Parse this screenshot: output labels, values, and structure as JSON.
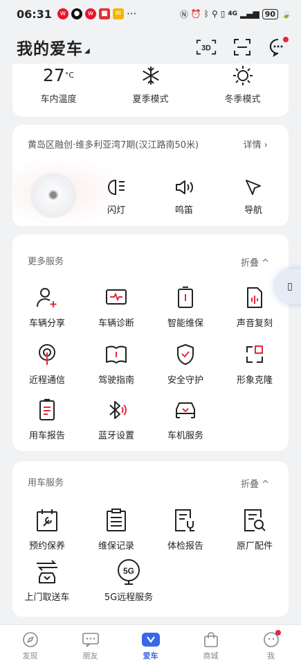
{
  "status": {
    "time": "06:31",
    "right_text": "4G",
    "battery": "90"
  },
  "header": {
    "title": "我的爱车",
    "btn_3d": "3D"
  },
  "climate": [
    {
      "value": "27",
      "unit": "°C",
      "label": "车内温度"
    },
    {
      "label": "夏季模式",
      "icon": "snowflake-icon"
    },
    {
      "label": "冬季模式",
      "icon": "sun-icon"
    }
  ],
  "location": {
    "address": "黄岛区融创·维多利亚湾7期(汉江路南50米)",
    "detail": "详情"
  },
  "quick_actions": [
    {
      "label": "闪灯",
      "icon": "headlight-icon"
    },
    {
      "label": "鸣笛",
      "icon": "horn-icon"
    },
    {
      "label": "导航",
      "icon": "navigation-icon"
    }
  ],
  "more_services": {
    "title": "更多服务",
    "fold": "折叠",
    "items": [
      {
        "label": "车辆分享",
        "icon": "user-add-icon"
      },
      {
        "label": "车辆诊断",
        "icon": "diagnosis-icon"
      },
      {
        "label": "智能维保",
        "icon": "battery-icon"
      },
      {
        "label": "声音复刻",
        "icon": "sound-clone-icon"
      },
      {
        "label": "近程通信",
        "icon": "signal-icon"
      },
      {
        "label": "驾驶指南",
        "icon": "book-icon"
      },
      {
        "label": "安全守护",
        "icon": "shield-icon"
      },
      {
        "label": "形象克隆",
        "icon": "clone-icon"
      },
      {
        "label": "用车报告",
        "icon": "report-icon"
      },
      {
        "label": "蓝牙设置",
        "icon": "bluetooth-icon"
      },
      {
        "label": "车机服务",
        "icon": "car-service-icon"
      }
    ]
  },
  "car_services": {
    "title": "用车服务",
    "fold": "折叠",
    "items": [
      {
        "label": "预约保养",
        "icon": "calendar-wrench-icon"
      },
      {
        "label": "维保记录",
        "icon": "clipboard-icon"
      },
      {
        "label": "体检报告",
        "icon": "checkup-icon"
      },
      {
        "label": "原厂配件",
        "icon": "parts-search-icon"
      },
      {
        "label": "上门取送车",
        "icon": "pickup-car-icon"
      },
      {
        "label": "5G远程服务",
        "icon": "5g-icon"
      }
    ],
    "fiveg_text": "5G"
  },
  "tabs": [
    {
      "label": "发现",
      "icon": "compass-icon"
    },
    {
      "label": "朋友",
      "icon": "chat-icon"
    },
    {
      "label": "爱车",
      "icon": "car-tab-icon"
    },
    {
      "label": "商城",
      "icon": "bag-icon"
    },
    {
      "label": "我",
      "icon": "face-icon"
    }
  ]
}
